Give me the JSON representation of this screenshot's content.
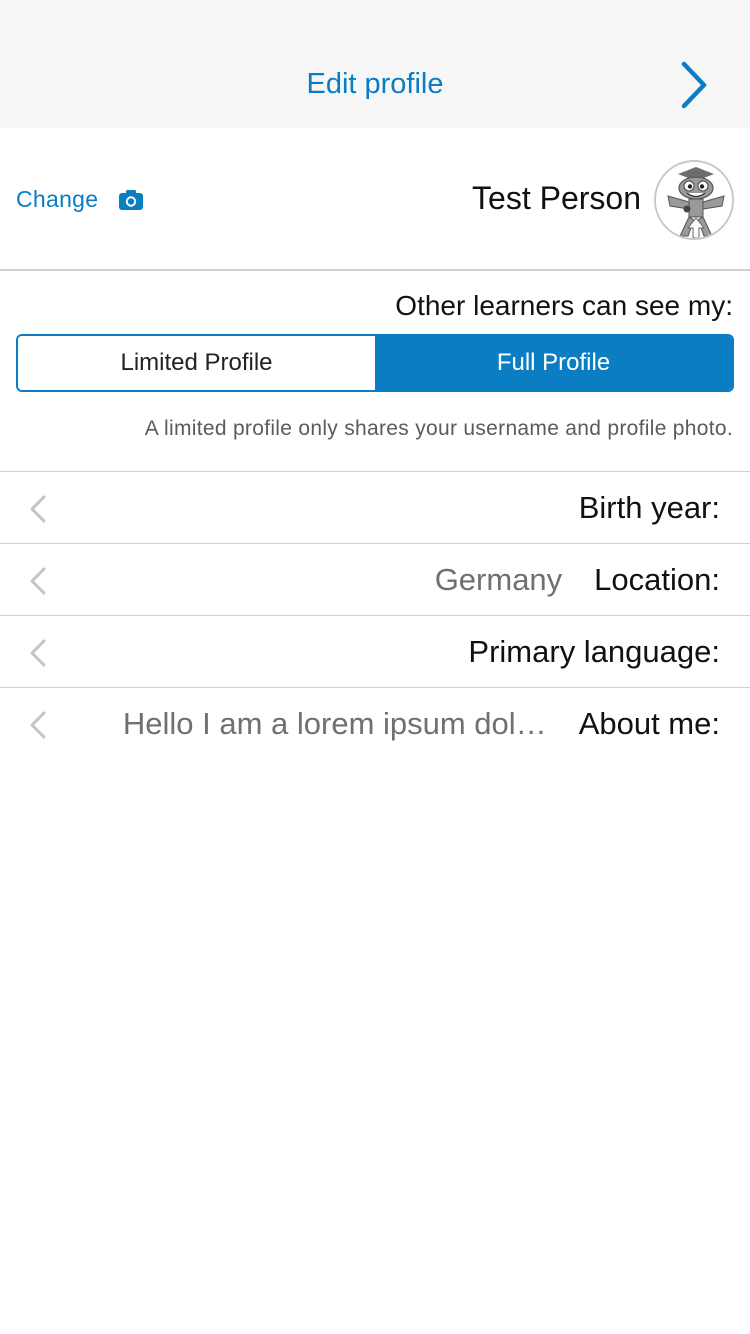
{
  "header": {
    "title": "Edit profile",
    "forward_icon": "chevron-right-icon",
    "accent_color": "#0a7dc3"
  },
  "photo": {
    "change_label": "Change",
    "camera_icon": "camera-icon",
    "name": "Test Person"
  },
  "visibility": {
    "label": "Other learners can see my:",
    "options": [
      "Limited Profile",
      "Full Profile"
    ],
    "selected": "Full Profile",
    "help_text": "A limited profile only shares your username and profile photo."
  },
  "fields": [
    {
      "label": "Birth year:",
      "value": ""
    },
    {
      "label": "Location:",
      "value": "Germany"
    },
    {
      "label": "Primary language:",
      "value": ""
    },
    {
      "label": "About me:",
      "value": "Hello I am a lorem ipsum dol…"
    }
  ]
}
